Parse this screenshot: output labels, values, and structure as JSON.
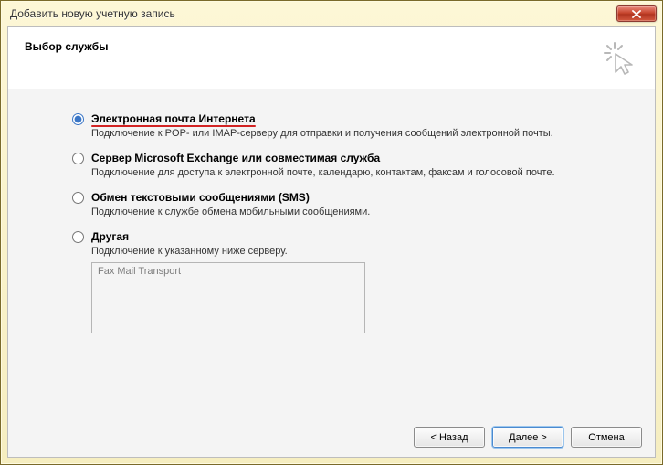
{
  "window": {
    "title": "Добавить новую учетную запись"
  },
  "header": {
    "title": "Выбор службы"
  },
  "options": {
    "internet": {
      "label": "Электронная почта Интернета",
      "desc": "Подключение к POP- или IMAP-серверу для отправки и получения сообщений электронной почты."
    },
    "exchange": {
      "label": "Сервер Microsoft Exchange или совместимая служба",
      "desc": "Подключение для доступа к электронной почте, календарю, контактам, факсам и голосовой почте."
    },
    "sms": {
      "label": "Обмен текстовыми сообщениями (SMS)",
      "desc": "Подключение к службе обмена мобильными сообщениями."
    },
    "other": {
      "label": "Другая",
      "desc": "Подключение к указанному ниже серверу.",
      "list_item": "Fax Mail Transport"
    }
  },
  "buttons": {
    "back": "< Назад",
    "next": "Далее >",
    "cancel": "Отмена"
  }
}
